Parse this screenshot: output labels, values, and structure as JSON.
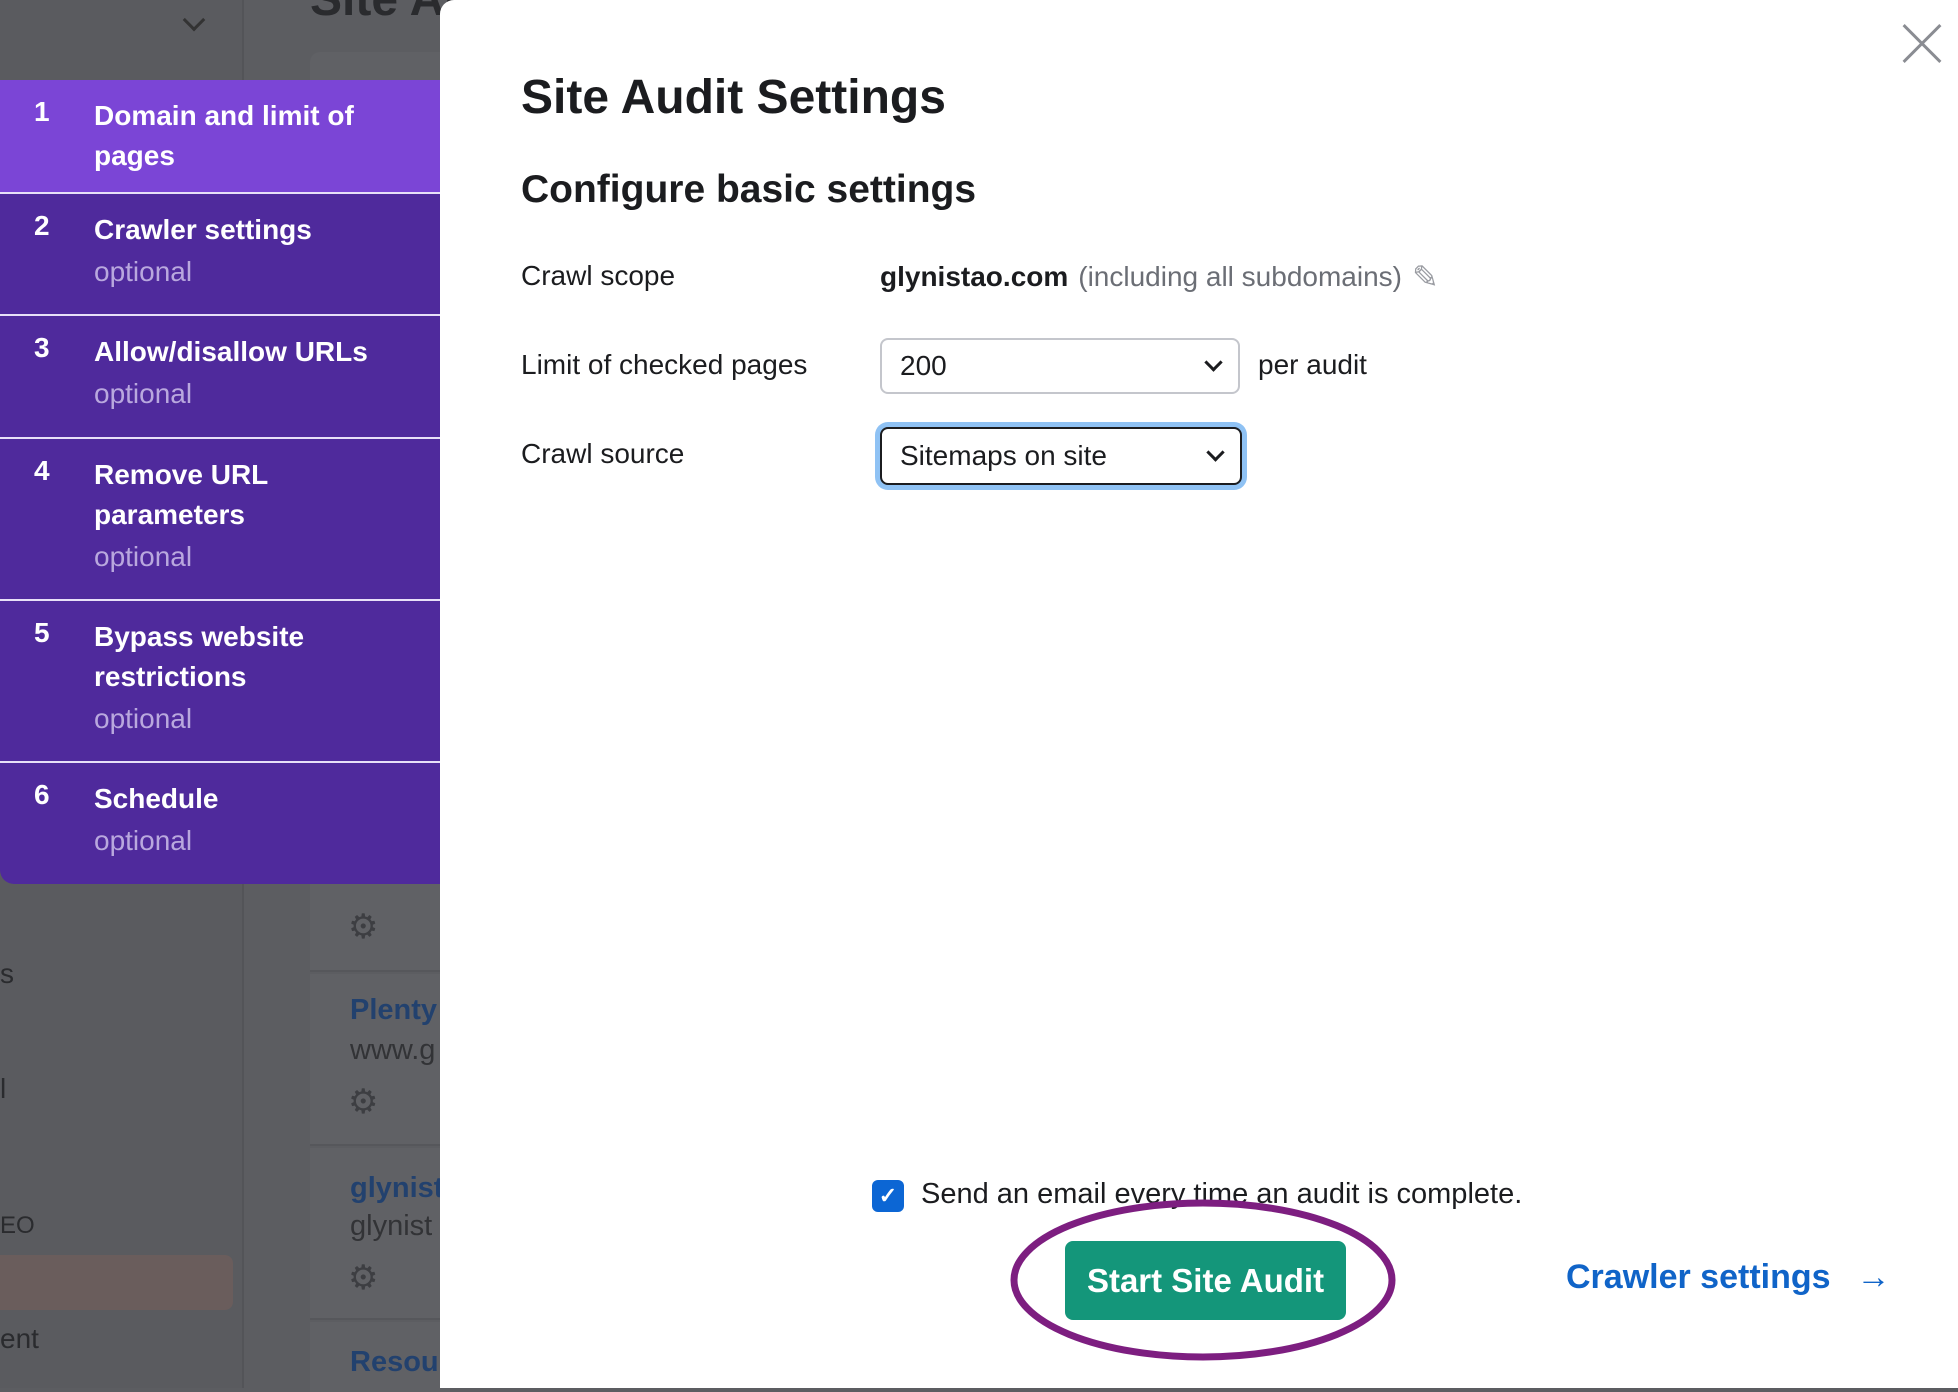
{
  "background": {
    "page_title_partial": "Site Au",
    "sidebar_fragments": [
      "s",
      "l",
      "EO",
      "ent"
    ],
    "cards": [
      {
        "title": "Plenty",
        "subtitle": "www.g"
      },
      {
        "title": "glynist",
        "subtitle": "glynist"
      },
      {
        "title": "Resou",
        "subtitle": ""
      }
    ]
  },
  "stepper": [
    {
      "num": "1",
      "title": "Domain and limit of pages",
      "optional": "",
      "active": true
    },
    {
      "num": "2",
      "title": "Crawler settings",
      "optional": "optional"
    },
    {
      "num": "3",
      "title": "Allow/disallow URLs",
      "optional": "optional"
    },
    {
      "num": "4",
      "title": "Remove URL parameters",
      "optional": "optional"
    },
    {
      "num": "5",
      "title": "Bypass website restrictions",
      "optional": "optional"
    },
    {
      "num": "6",
      "title": "Schedule",
      "optional": "optional"
    }
  ],
  "modal": {
    "title": "Site Audit Settings",
    "subtitle": "Configure basic settings",
    "crawl_scope": {
      "label": "Crawl scope",
      "domain": "glynistao.com",
      "note": "(including all subdomains)",
      "icon": "pencil-icon"
    },
    "limit": {
      "label": "Limit of checked pages",
      "value": "200",
      "suffix": "per audit"
    },
    "source": {
      "label": "Crawl source",
      "value": "Sitemaps on site"
    },
    "email_checkbox": {
      "label": "Send an email every time an audit is complete.",
      "checked": true
    },
    "start_button": "Start Site Audit",
    "next_link": "Crawler settings",
    "next_arrow": "→",
    "colors": {
      "accent": "#7b45d6",
      "step": "#4f2a9c",
      "button": "#14967a",
      "link": "#1064c8",
      "highlight_ellipse": "#7d1e80"
    }
  }
}
